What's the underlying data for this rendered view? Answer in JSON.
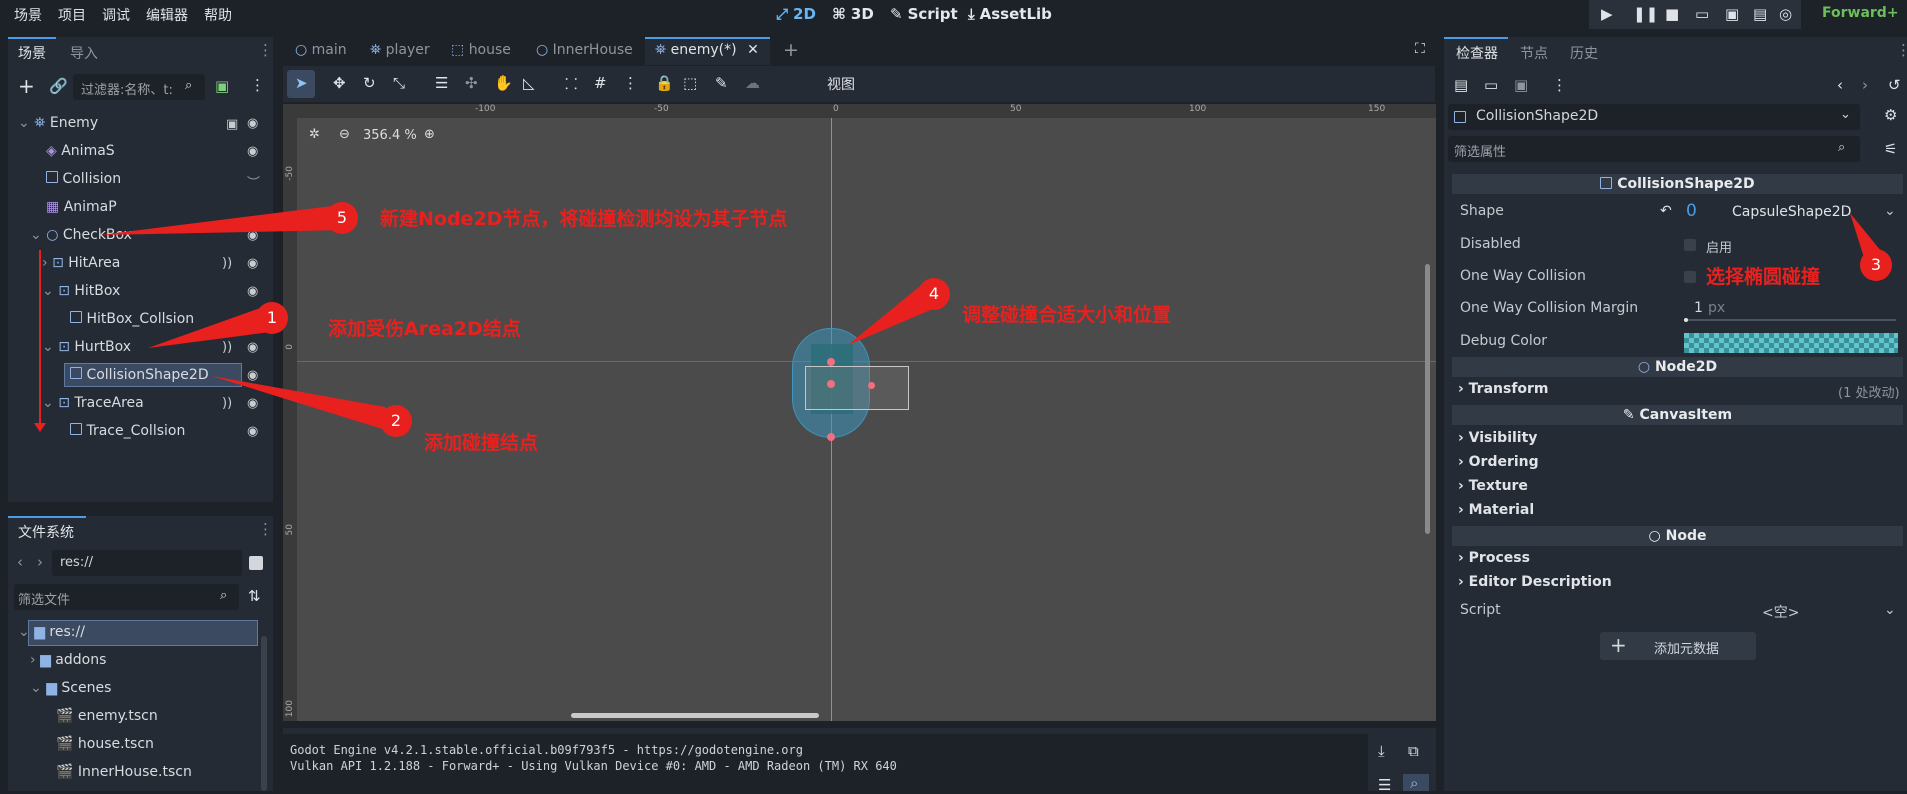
{
  "menu": [
    "场景",
    "项目",
    "调试",
    "编辑器",
    "帮助"
  ],
  "modes": {
    "m2d": "2D",
    "m3d": "3D",
    "script": "Script",
    "assetlib": "AssetLib"
  },
  "renderer": "Forward+",
  "scene_dock": {
    "tabs": [
      "场景",
      "导入"
    ],
    "filter_placeholder": "过滤器:名称、t:",
    "nodes": [
      {
        "label": "Enemy"
      },
      {
        "label": "AnimaS"
      },
      {
        "label": "Collision"
      },
      {
        "label": "AnimaP"
      },
      {
        "label": "CheckBox"
      },
      {
        "label": "HitArea"
      },
      {
        "label": "HitBox"
      },
      {
        "label": "HitBox_Collsion"
      },
      {
        "label": "HurtBox"
      },
      {
        "label": "CollisionShape2D"
      },
      {
        "label": "TraceArea"
      },
      {
        "label": "Trace_Collsion"
      }
    ]
  },
  "filesystem": {
    "title": "文件系统",
    "path": "res://",
    "filter_placeholder": "筛选文件",
    "items": [
      {
        "label": "res://"
      },
      {
        "label": "addons"
      },
      {
        "label": "Scenes"
      },
      {
        "label": "enemy.tscn"
      },
      {
        "label": "house.tscn"
      },
      {
        "label": "InnerHouse.tscn"
      }
    ]
  },
  "editor_tabs": [
    {
      "label": "main"
    },
    {
      "label": "player"
    },
    {
      "label": "house"
    },
    {
      "label": "InnerHouse"
    },
    {
      "label": "enemy(*)"
    }
  ],
  "toolbar": {
    "view": "视图"
  },
  "viewport": {
    "zoom": "356.4 %",
    "ruler_top": [
      "-100",
      "-50",
      "0",
      "50",
      "100",
      "150"
    ],
    "ruler_left": [
      "-50",
      "0",
      "50",
      "100"
    ]
  },
  "console": {
    "line1": "Godot Engine v4.2.1.stable.official.b09f793f5 - https://godotengine.org",
    "line2": "Vulkan API 1.2.188 - Forward+ - Using Vulkan Device #0: AMD - AMD Radeon (TM) RX 640"
  },
  "inspector": {
    "tabs": [
      "检查器",
      "节点",
      "历史"
    ],
    "node_name": "CollisionShape2D",
    "filter_placeholder": "筛选属性",
    "section_title": "CollisionShape2D",
    "props": {
      "shape_label": "Shape",
      "shape_value": "CapsuleShape2D",
      "shape_count": "0",
      "disabled_label": "Disabled",
      "disabled_value": "启用",
      "owc_label": "One Way Collision",
      "owcm_label": "One Way Collision Margin",
      "owcm_value": "1",
      "owcm_unit": "px",
      "debug_label": "Debug Color"
    },
    "node2d": "Node2D",
    "transform": "Transform",
    "transform_note": "(1 处改动)",
    "canvasitem": "CanvasItem",
    "visibility": "Visibility",
    "ordering": "Ordering",
    "texture": "Texture",
    "material": "Material",
    "node": "Node",
    "process": "Process",
    "editor_desc": "Editor Description",
    "script_label": "Script",
    "script_value": "<空>",
    "add_meta": "添加元数据"
  },
  "annotations": {
    "a1": "添加受伤Area2D结点",
    "a2": "添加碰撞结点",
    "a3": "选择椭圆碰撞",
    "a4": "调整碰撞合适大小和位置",
    "a5": "新建Node2D节点，将碰撞检测均设为其子节点",
    "n1": "1",
    "n2": "2",
    "n3": "3",
    "n4": "4",
    "n5": "5"
  }
}
